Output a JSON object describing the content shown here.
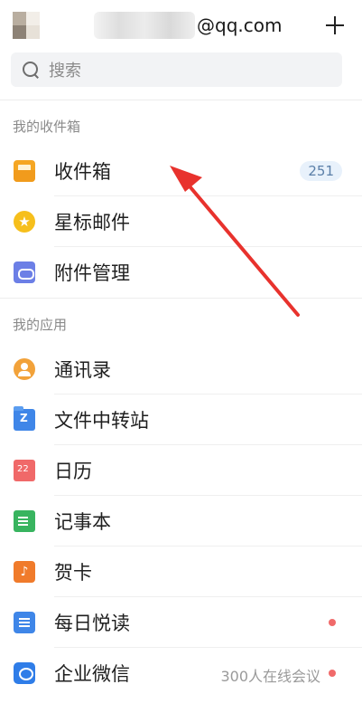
{
  "header": {
    "account_domain": "@qq.com",
    "add_icon": "plus-icon"
  },
  "search": {
    "placeholder": "搜索",
    "icon": "search-icon"
  },
  "sections": {
    "inbox_section_title": "我的收件箱",
    "apps_section_title": "我的应用"
  },
  "mailbox_items": [
    {
      "label": "收件箱",
      "icon": "inbox-icon",
      "count": "251"
    },
    {
      "label": "星标邮件",
      "icon": "star-icon"
    },
    {
      "label": "附件管理",
      "icon": "attachment-icon"
    }
  ],
  "app_items": [
    {
      "label": "通讯录",
      "icon": "contacts-icon"
    },
    {
      "label": "文件中转站",
      "icon": "folder-icon",
      "icon_text": "Z"
    },
    {
      "label": "日历",
      "icon": "calendar-icon",
      "icon_text": "22"
    },
    {
      "label": "记事本",
      "icon": "notebook-icon"
    },
    {
      "label": "贺卡",
      "icon": "greeting-card-icon"
    },
    {
      "label": "每日悦读",
      "icon": "daily-reading-icon",
      "unread_dot": true
    },
    {
      "label": "企业微信",
      "icon": "wework-icon",
      "side_text": "300人在线会议",
      "unread_dot": true
    }
  ],
  "colors": {
    "arrow": "#e8322d",
    "badge_bg": "#e8f1fb",
    "dot": "#f06a6a"
  }
}
